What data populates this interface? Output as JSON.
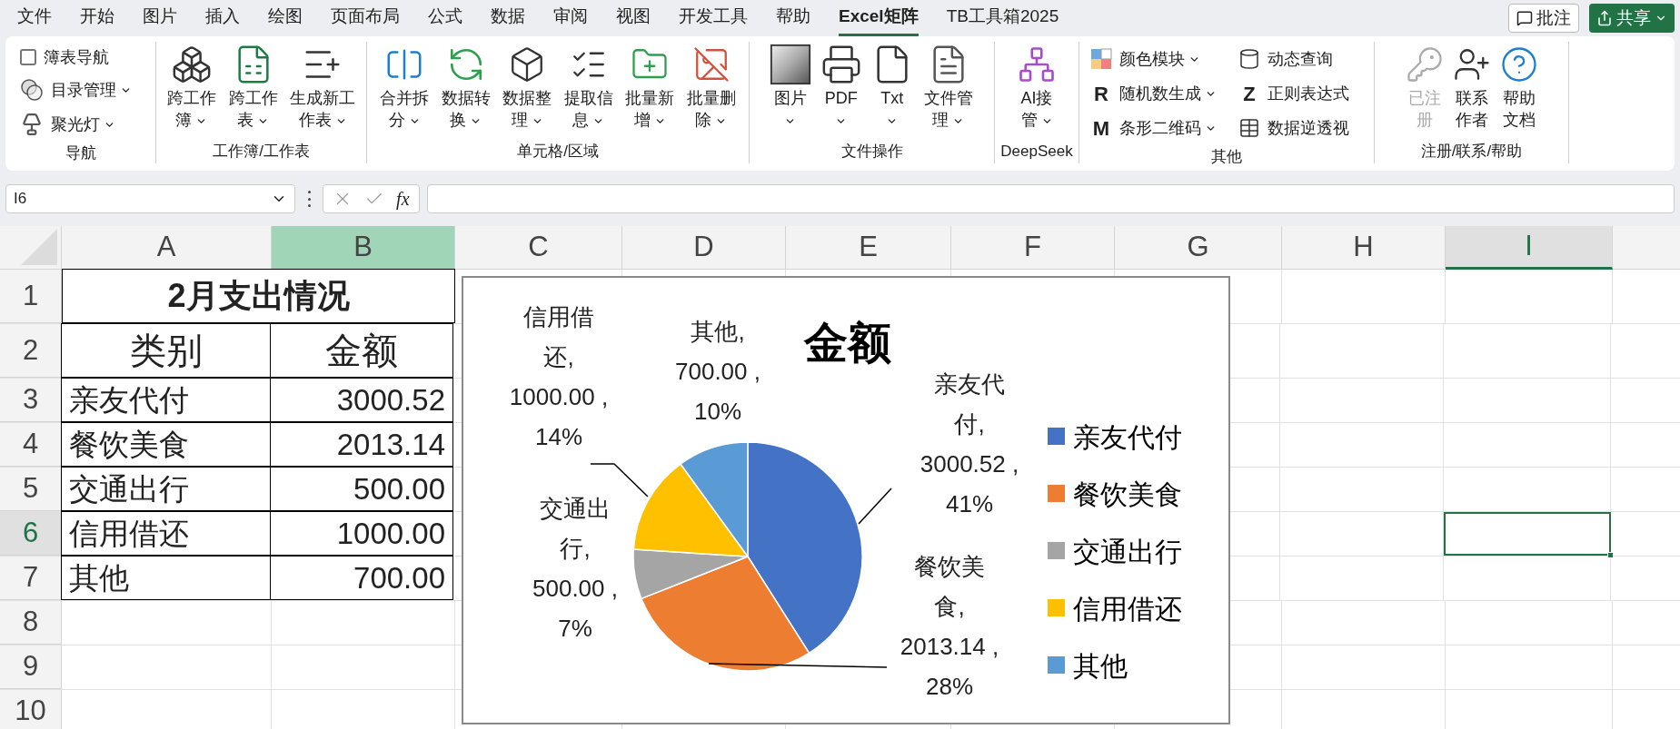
{
  "menu_tabs": [
    {
      "label": "文件",
      "selected": false
    },
    {
      "label": "开始",
      "selected": false
    },
    {
      "label": "图片",
      "selected": false
    },
    {
      "label": "插入",
      "selected": false
    },
    {
      "label": "绘图",
      "selected": false
    },
    {
      "label": "页面布局",
      "selected": false
    },
    {
      "label": "公式",
      "selected": false
    },
    {
      "label": "数据",
      "selected": false
    },
    {
      "label": "审阅",
      "selected": false
    },
    {
      "label": "视图",
      "selected": false
    },
    {
      "label": "开发工具",
      "selected": false
    },
    {
      "label": "帮助",
      "selected": false
    },
    {
      "label": "Excel矩阵",
      "selected": true
    },
    {
      "label": "TB工具箱2025",
      "selected": false
    }
  ],
  "top_buttons": {
    "comment": "批注",
    "share": "共享"
  },
  "ribbon_groups": [
    {
      "title": "导航",
      "items": [
        {
          "kind": "checkbox",
          "label": "簿表导航",
          "checked": false
        },
        {
          "kind": "small",
          "label": "目录管理",
          "dropdown": true
        },
        {
          "kind": "small",
          "label": "聚光灯",
          "dropdown": true
        }
      ]
    },
    {
      "title": "工作簿/工作表",
      "items": [
        {
          "kind": "large",
          "label": "跨工作簿",
          "dropdown": true,
          "disabled": false
        },
        {
          "kind": "large",
          "label": "跨工作表",
          "dropdown": true,
          "disabled": false
        },
        {
          "kind": "large",
          "label": "生成新工作表",
          "dropdown": true,
          "disabled": false
        }
      ]
    },
    {
      "title": "单元格/区域",
      "items": [
        {
          "kind": "large",
          "label": "合并拆分",
          "dropdown": true,
          "disabled": false
        },
        {
          "kind": "large",
          "label": "数据转换",
          "dropdown": true,
          "disabled": false
        },
        {
          "kind": "large",
          "label": "数据整理",
          "dropdown": true,
          "disabled": false
        },
        {
          "kind": "large",
          "label": "提取信息",
          "dropdown": true,
          "disabled": false
        },
        {
          "kind": "large",
          "label": "批量新增",
          "dropdown": true,
          "disabled": false
        },
        {
          "kind": "large",
          "label": "批量删除",
          "dropdown": true,
          "disabled": false
        }
      ]
    },
    {
      "title": "文件操作",
      "items": [
        {
          "kind": "large",
          "label": "图片",
          "dropdown": true,
          "disabled": false
        },
        {
          "kind": "large",
          "label": "PDF",
          "dropdown": true,
          "disabled": false
        },
        {
          "kind": "large",
          "label": "Txt",
          "dropdown": true,
          "disabled": false
        },
        {
          "kind": "large",
          "label": "文件管理",
          "dropdown": true,
          "disabled": false
        }
      ]
    },
    {
      "title": "DeepSeek",
      "items": [
        {
          "kind": "large",
          "label": "AI接管",
          "dropdown": true,
          "disabled": false
        }
      ]
    },
    {
      "title": "其他",
      "items": [
        {
          "kind": "small",
          "label": "颜色模块",
          "dropdown": true
        },
        {
          "kind": "small",
          "glyph": "R",
          "label": "随机数生成",
          "dropdown": true
        },
        {
          "kind": "small",
          "glyph": "M",
          "label": "条形二维码",
          "dropdown": true
        },
        {
          "kind": "small",
          "label": "动态查询",
          "dropdown": false
        },
        {
          "kind": "small",
          "glyph": "Z",
          "label": "正则表达式",
          "dropdown": false
        },
        {
          "kind": "small",
          "label": "数据逆透视",
          "dropdown": false
        }
      ]
    },
    {
      "title": "注册/联系/帮助",
      "items": [
        {
          "kind": "large",
          "label": "已注册",
          "dropdown": false,
          "disabled": true
        },
        {
          "kind": "large",
          "label": "联系作者",
          "dropdown": false,
          "disabled": false
        },
        {
          "kind": "large",
          "label": "帮助文档",
          "dropdown": false,
          "disabled": false
        }
      ]
    }
  ],
  "formula_bar": {
    "name_box": "I6",
    "fx": "fx"
  },
  "sheet": {
    "columns": [
      {
        "label": "A",
        "selected": false,
        "highlighted": false
      },
      {
        "label": "B",
        "selected": false,
        "highlighted": true
      },
      {
        "label": "C",
        "selected": false,
        "highlighted": false
      },
      {
        "label": "D",
        "selected": false,
        "highlighted": false
      },
      {
        "label": "E",
        "selected": false,
        "highlighted": false
      },
      {
        "label": "F",
        "selected": false,
        "highlighted": false
      },
      {
        "label": "G",
        "selected": false,
        "highlighted": false
      },
      {
        "label": "H",
        "selected": false,
        "highlighted": false
      },
      {
        "label": "I",
        "selected": true,
        "highlighted": false
      }
    ],
    "rows": [
      {
        "label": "1",
        "selected": false,
        "cells": [
          {
            "kind": "title",
            "text": "2月支出情况"
          }
        ]
      },
      {
        "label": "2",
        "selected": false,
        "cells": [
          {
            "kind": "header",
            "text": "类别"
          },
          {
            "kind": "header",
            "text": "金额"
          }
        ]
      },
      {
        "label": "3",
        "selected": false,
        "cells": [
          {
            "kind": "text",
            "text": "亲友代付"
          },
          {
            "kind": "number",
            "text": "3000.52"
          }
        ]
      },
      {
        "label": "4",
        "selected": false,
        "cells": [
          {
            "kind": "text",
            "text": "餐饮美食"
          },
          {
            "kind": "number",
            "text": "2013.14"
          }
        ]
      },
      {
        "label": "5",
        "selected": false,
        "cells": [
          {
            "kind": "text",
            "text": "交通出行"
          },
          {
            "kind": "number",
            "text": "500.00"
          }
        ]
      },
      {
        "label": "6",
        "selected": true,
        "cells": [
          {
            "kind": "text",
            "text": "信用借还"
          },
          {
            "kind": "number",
            "text": "1000.00"
          }
        ]
      },
      {
        "label": "7",
        "selected": false,
        "cells": [
          {
            "kind": "text",
            "text": "其他"
          },
          {
            "kind": "number",
            "text": "700.00"
          }
        ]
      },
      {
        "label": "8",
        "selected": false,
        "cells": []
      },
      {
        "label": "9",
        "selected": false,
        "cells": []
      },
      {
        "label": "10",
        "selected": false,
        "cells": []
      }
    ]
  },
  "chart": {
    "chart_data": {
      "type": "pie",
      "title": "金额",
      "categories": [
        "亲友代付",
        "餐饮美食",
        "交通出行",
        "信用借还",
        "其他"
      ],
      "values": [
        41,
        28,
        7,
        14,
        10
      ],
      "legend": "right"
    },
    "slices": [
      {
        "color": "#4472c4"
      },
      {
        "color": "#ed7d31"
      },
      {
        "color": "#a5a5a5"
      },
      {
        "color": "#ffc000"
      },
      {
        "color": "#5b9bd5"
      }
    ],
    "data_labels": [
      {
        "category": "信用借还,",
        "value": "1000.00 ,",
        "percent": "14%"
      },
      {
        "category": "其他,",
        "value": "700.00 ,",
        "percent": "10%"
      },
      {
        "category": "亲友代付,",
        "value": "3000.52 ,",
        "percent": "41%"
      },
      {
        "category": "交通出行,",
        "value": "500.00 ,",
        "percent": "7%"
      },
      {
        "category": "餐饮美食,",
        "value": "2013.14 ,",
        "percent": "28%"
      }
    ]
  }
}
